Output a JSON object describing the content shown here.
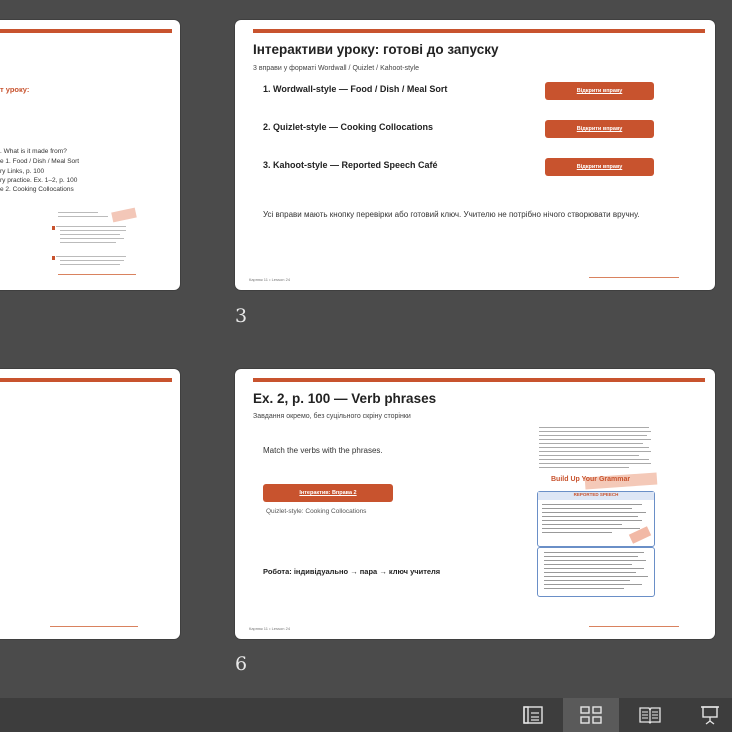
{
  "slides": {
    "s2": {
      "title_fragment": "т уроку:",
      "lines": [
        ". What is it made from?",
        "e 1. Food / Dish / Meal Sort",
        "ry Links, p. 100",
        "ry practice. Ex. 1–2, p. 100",
        "e 2. Cooking Collocations"
      ]
    },
    "s3": {
      "title": "Інтерактиви уроку: готові до запуску",
      "subtitle": "3 вправи у форматі Wordwall / Quizlet / Kahoot-style",
      "items": [
        {
          "label": "1. Wordwall-style — Food / Dish / Meal Sort",
          "button": "Відкрити вправу"
        },
        {
          "label": "2. Quizlet-style — Cooking Collocations",
          "button": "Відкрити вправу"
        },
        {
          "label": "3. Kahoot-style — Reported Speech Café",
          "button": "Відкрити вправу"
        }
      ],
      "note": "Усі вправи мають кнопку перевірки або готовий ключ. Учителю не потрібно нічого створювати вручну.",
      "footer": "Карпюк 11 • Lesson 24",
      "number": "3"
    },
    "s6": {
      "title": "Ex. 2, p. 100 — Verb phrases",
      "subtitle": "Завдання окремо, без суцільного скріну сторінки",
      "instruction": "Match the verbs with the phrases.",
      "button": "Інтерактив: Вправа 2",
      "caption": "Quizlet-style: Cooking Collocations",
      "work": "Робота: індивідуально → пара → ключ учителя",
      "book_heading": "Build Up Your Grammar",
      "book_box_title": "REPORTED SPEECH",
      "footer": "Карпюк 11 • Lesson 24",
      "number": "6"
    }
  },
  "statusbar": {
    "buttons": [
      {
        "name": "normal-view-icon",
        "active": false
      },
      {
        "name": "slide-sorter-icon",
        "active": true
      },
      {
        "name": "reading-view-icon",
        "active": false
      },
      {
        "name": "slideshow-icon",
        "active": false
      }
    ]
  },
  "colors": {
    "accent": "#c8532e",
    "background": "#4b4b4b"
  }
}
